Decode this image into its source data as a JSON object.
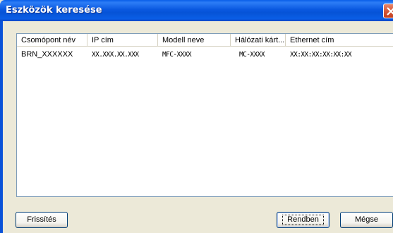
{
  "window": {
    "title": "Eszközök keresése"
  },
  "listview": {
    "columns": [
      "Csomópont név",
      "IP cím",
      "Modell neve",
      "Hálózati kárt...",
      "Ethernet cím"
    ],
    "rows": [
      {
        "node_name": "BRN_XXXXXX",
        "ip": "XX.XXX.XX.XXX",
        "model": "MFC-XXXX",
        "network_card": "MC-XXXX",
        "ethernet": "XX:XX:XX:XX:XX:XX"
      }
    ]
  },
  "buttons": {
    "refresh": "Frissítés",
    "ok": "Rendben",
    "cancel": "Mégse"
  }
}
